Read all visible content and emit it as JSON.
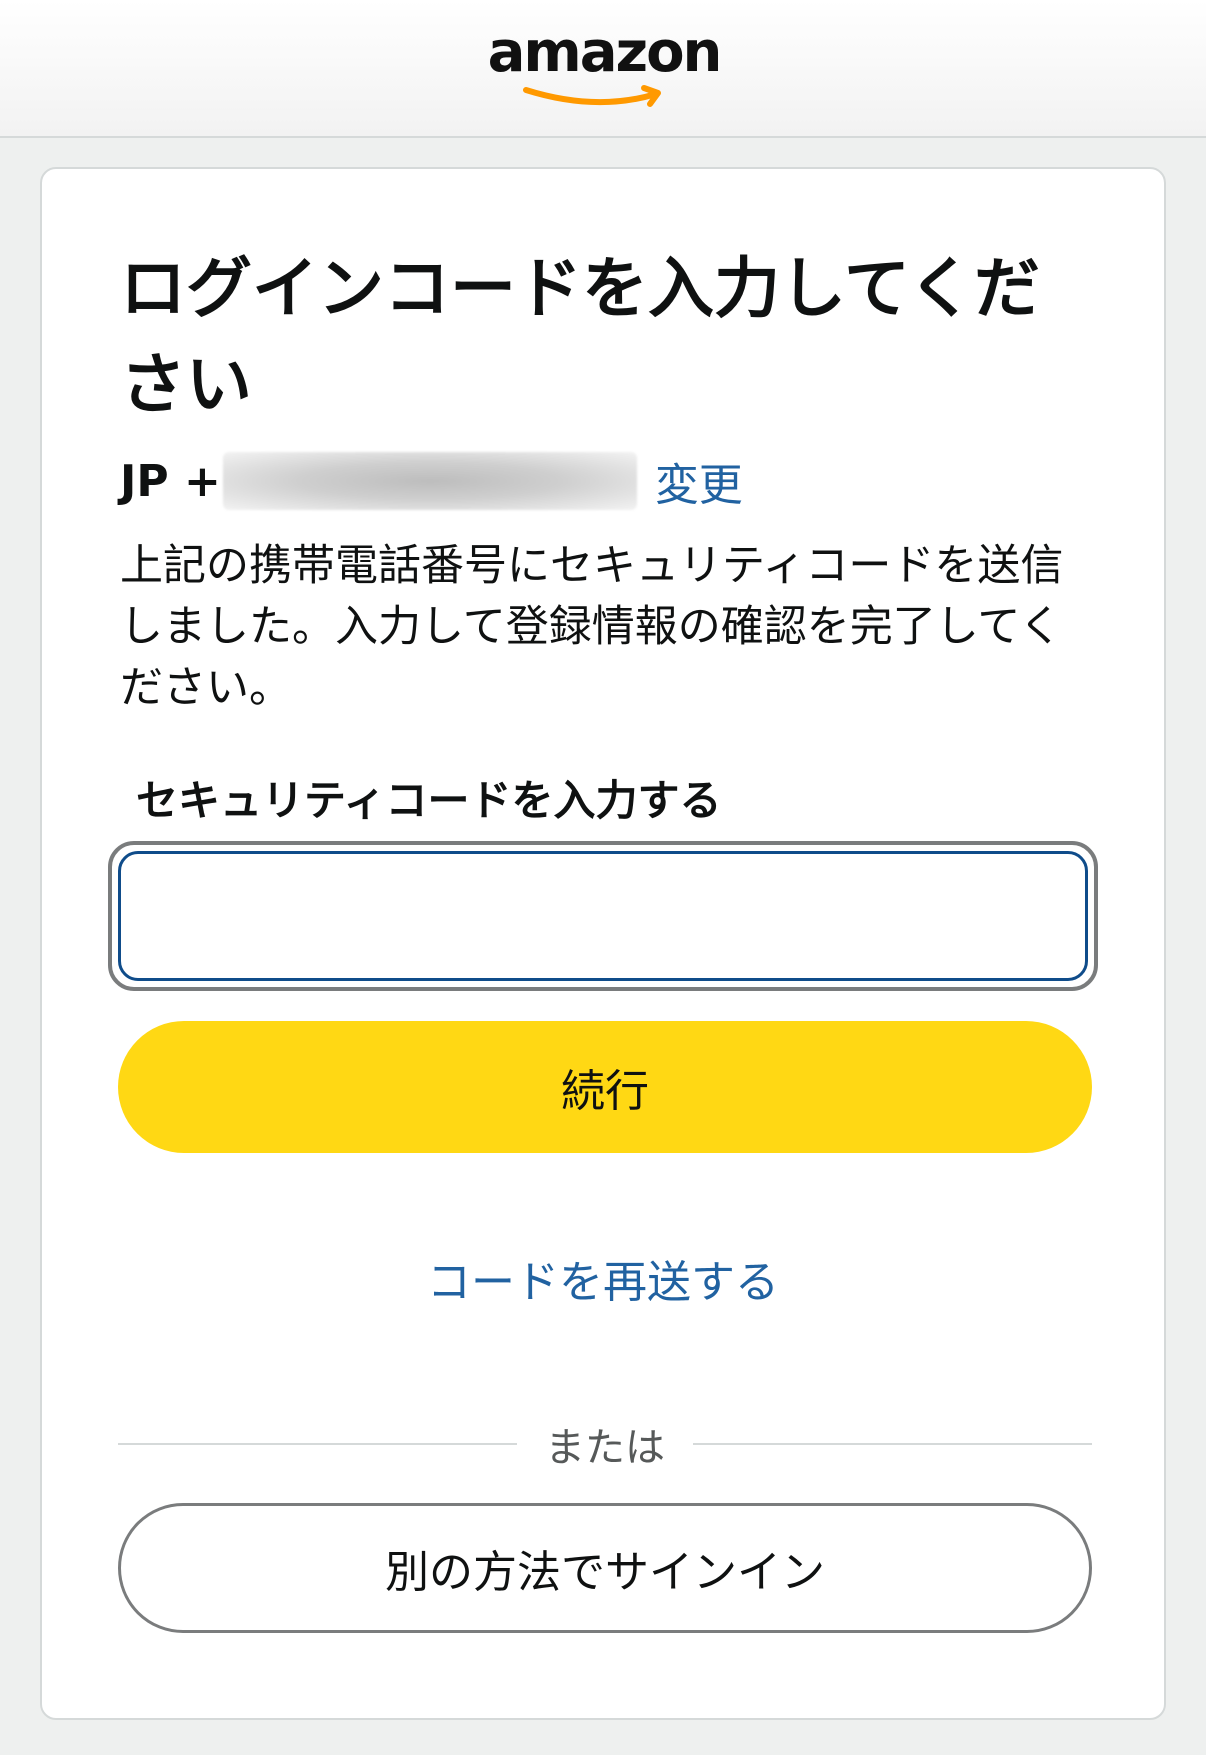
{
  "header": {
    "logo_text": "amazon"
  },
  "card": {
    "title": "ログインコードを入力してください",
    "phone_prefix": "JP +",
    "change_link": "変更",
    "description": "上記の携帯電話番号にセキュリティコードを送信しました。入力して登録情報の確認を完了してください。",
    "field_label": "セキュリティコードを入力する",
    "code_input_value": "",
    "continue_button": "続行",
    "resend_link": "コードを再送する",
    "divider_text": "または",
    "alt_signin_button": "別の方法でサインイン"
  },
  "colors": {
    "accent_link": "#2162a1",
    "primary_button": "#ffd814",
    "logo_smile": "#ff9900"
  }
}
